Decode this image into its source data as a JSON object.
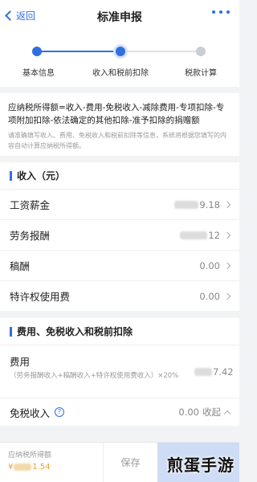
{
  "header": {
    "back_label": "返回",
    "title": "标准申报"
  },
  "steps": [
    {
      "label": "基本信息",
      "state": "done"
    },
    {
      "label": "收入和税前扣除",
      "state": "active"
    },
    {
      "label": "税款计算",
      "state": "todo"
    }
  ],
  "colors": {
    "accent": "#2f6fe0",
    "inactive": "#c9cdd4",
    "warning": "#e6a23c"
  },
  "formula": {
    "text": "应纳税所得额=收入-费用-免税收入-减除费用-专项扣除-专项附加扣除-依法确定的其他扣除-准予扣除的捐赠额",
    "tip": "请准确填写收入、费用、免税收入和税前扣除等信息，系统将根据您填写的内容自动计算应纳税所得额。"
  },
  "income": {
    "section_title": "收入（元）",
    "rows": [
      {
        "label": "工资薪金",
        "value": "9.18",
        "value_masked": true
      },
      {
        "label": "劳务报酬",
        "value": "12",
        "value_masked": true
      },
      {
        "label": "稿酬",
        "value": "0.00",
        "value_masked": false
      },
      {
        "label": "特许权使用费",
        "value": "0.00",
        "value_masked": false
      }
    ]
  },
  "deductions": {
    "section_title": "费用、免税收入和税前扣除",
    "expense": {
      "label": "费用",
      "formula": "（劳务报酬收入+稿酬收入+特许权使用费收入）×20%",
      "value": "7.42"
    },
    "exempt": {
      "label": "免税收入",
      "help": "?",
      "value": "0.00",
      "toggle_label": "收起"
    }
  },
  "bottom": {
    "taxable_label": "应纳税所得额",
    "currency": "¥",
    "taxable_value": "1.54",
    "save_label": "保存"
  },
  "watermark": "煎蛋手游"
}
